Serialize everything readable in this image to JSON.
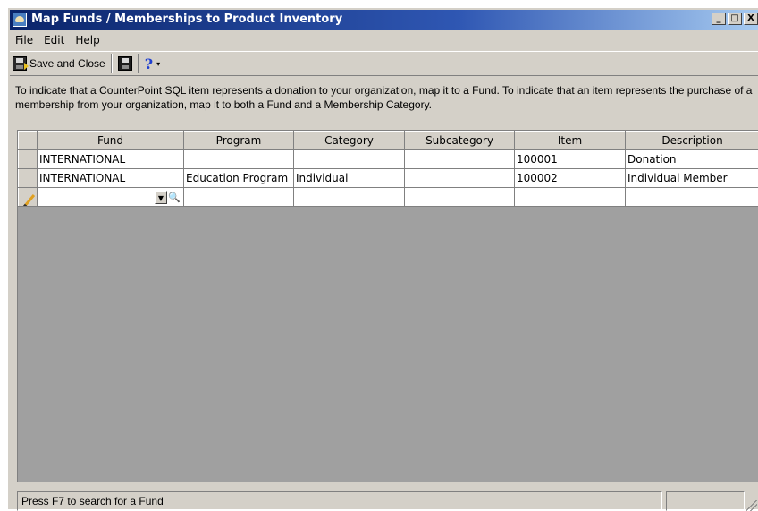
{
  "window": {
    "title": "Map Funds / Memberships to Product Inventory",
    "minimize": "_",
    "maximize": "□",
    "close": "X"
  },
  "menu": [
    "File",
    "Edit",
    "Help"
  ],
  "toolbar": {
    "save_close_label": "Save and Close",
    "help_glyph": "?",
    "dropdown_glyph": "▾"
  },
  "instructions": "To indicate that a CounterPoint SQL item represents a donation to your organization, map it to a Fund.  To indicate that an item represents the purchase of a membership from your organization, map it to both a Fund and a Membership Category.",
  "grid": {
    "columns": [
      "Fund",
      "Program",
      "Category",
      "Subcategory",
      "Item",
      "Description"
    ],
    "rows": [
      [
        "INTERNATIONAL",
        "",
        "",
        "",
        "100001",
        "Donation"
      ],
      [
        "INTERNATIONAL",
        "Education Program",
        "Individual",
        "",
        "100002",
        "Individual Member"
      ]
    ],
    "editor": {
      "drop_glyph": "▼",
      "search_glyph": "🔍"
    }
  },
  "status": {
    "text": "Press F7 to search for a Fund"
  }
}
